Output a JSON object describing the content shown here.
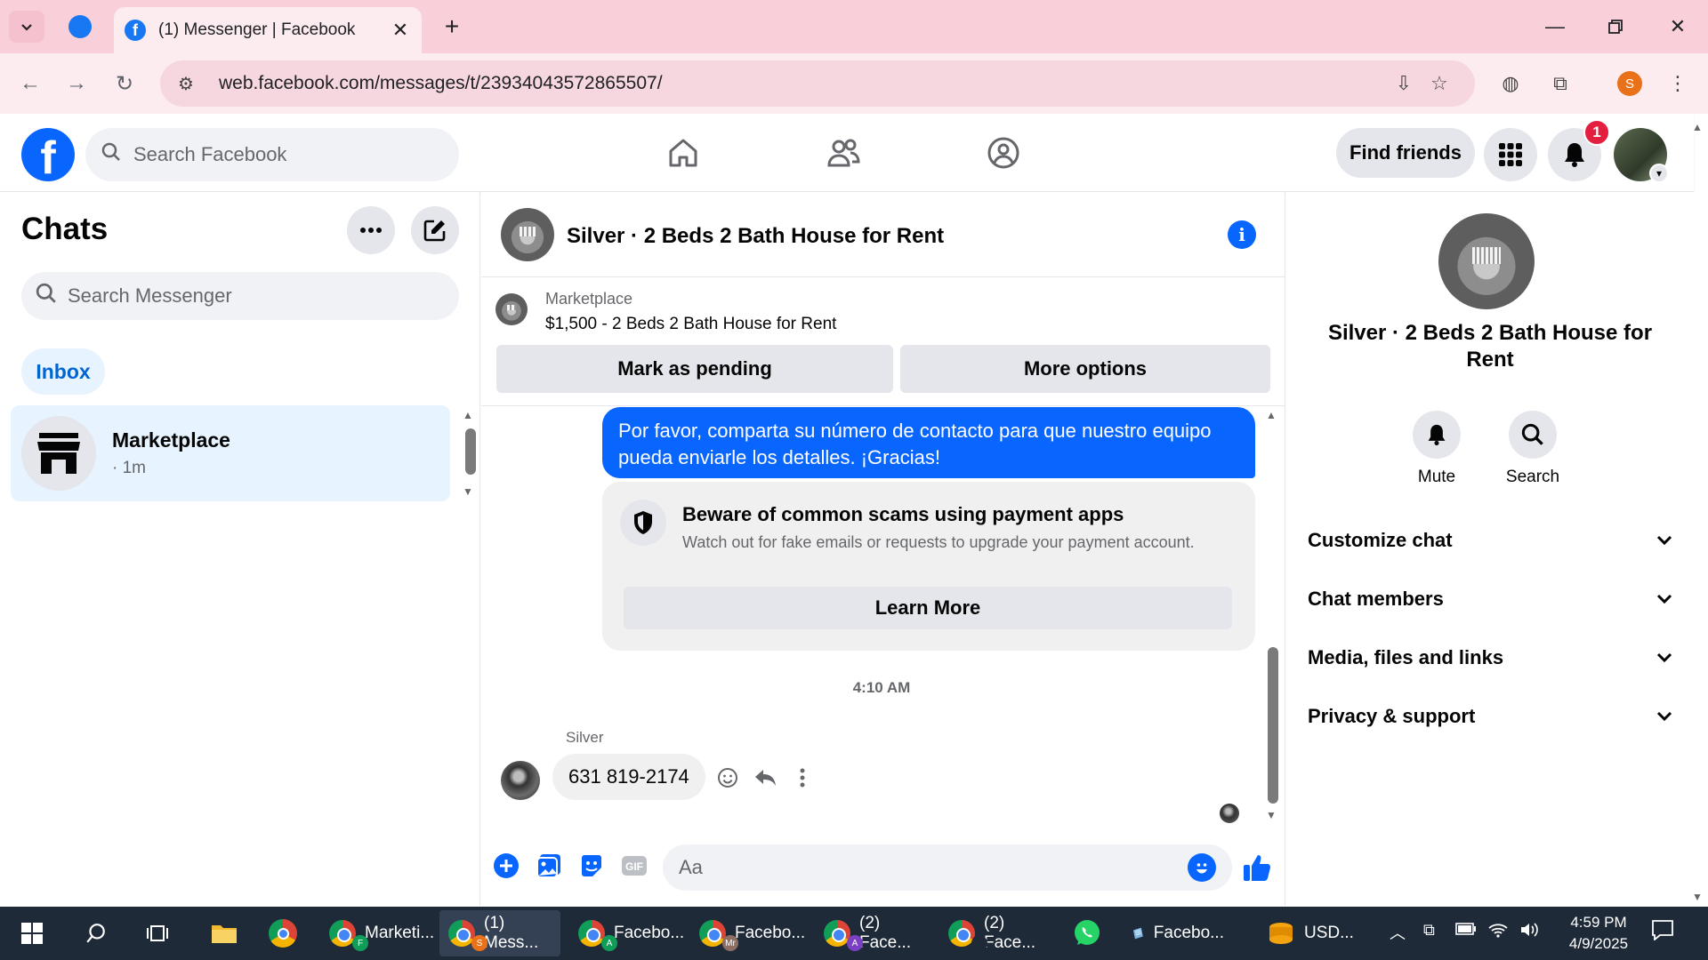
{
  "browser": {
    "tab_title": "(1) Messenger | Facebook",
    "url": "web.facebook.com/messages/t/23934043572865507/",
    "profile_initial": "S"
  },
  "fb": {
    "search_placeholder": "Search Facebook",
    "find_friends": "Find friends",
    "notification_count": "1"
  },
  "sidebar": {
    "title": "Chats",
    "search_placeholder": "Search Messenger",
    "filter_inbox": "Inbox",
    "chats": [
      {
        "name": "Marketplace",
        "time": "· 1m"
      }
    ]
  },
  "conversation": {
    "title": "Silver · 2 Beds 2 Bath House for Rent",
    "marketplace_label": "Marketplace",
    "listing": "$1,500 - 2 Beds 2 Bath House for Rent",
    "mark_pending": "Mark as pending",
    "more_options": "More options",
    "outgoing_message": "Por favor, comparta su número de contacto para que nuestro equipo pueda enviarle los detalles. ¡Gracias!",
    "scam_title": "Beware of common scams using payment apps",
    "scam_body": "Watch out for fake emails or requests to upgrade your payment account.",
    "learn_more": "Learn More",
    "timestamp": "4:10 AM",
    "sender_name": "Silver",
    "incoming_message": "631 819-2174",
    "composer_placeholder": "Aa",
    "gif_label": "GIF"
  },
  "right_panel": {
    "title": "Silver · 2 Beds 2 Bath House for Rent",
    "mute": "Mute",
    "search": "Search",
    "sections": [
      "Customize chat",
      "Chat members",
      "Media, files and links",
      "Privacy & support"
    ]
  },
  "taskbar": {
    "apps": [
      "Marketi...",
      "(1) Mess...",
      "Facebo...",
      "Facebo...",
      "(2) Face...",
      "(2) Face...",
      "Facebo...",
      "USD..."
    ],
    "app_badges": [
      "F",
      "S",
      "A",
      "Mr",
      "A",
      ""
    ],
    "time": "4:59 PM",
    "date": "4/9/2025"
  },
  "colors": {
    "facebook_blue": "#0866ff",
    "tab_bar": "#f9cfd9",
    "badge_red": "#e41e3f",
    "selected_chat": "#e7f3ff"
  }
}
